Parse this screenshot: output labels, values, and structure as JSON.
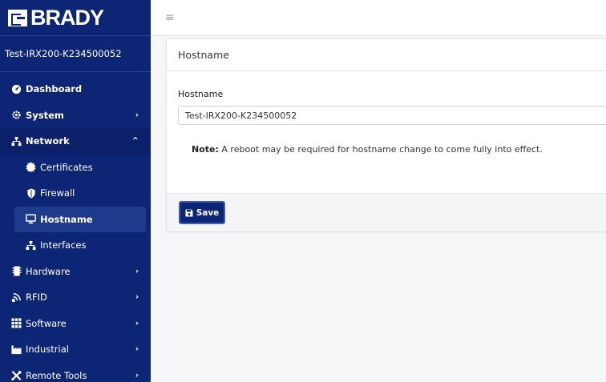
{
  "brand": {
    "name": "BRADY"
  },
  "sidebar": {
    "device_name": "Test-IRX200-K234500052",
    "items": [
      {
        "label": "Dashboard",
        "icon": "dashboard-icon"
      },
      {
        "label": "System",
        "icon": "gears-icon",
        "chevron": "›"
      },
      {
        "label": "Network",
        "icon": "network-icon",
        "chevron": "^"
      },
      {
        "label": "Certificates",
        "icon": "certificate-icon"
      },
      {
        "label": "Firewall",
        "icon": "shield-icon"
      },
      {
        "label": "Hostname",
        "icon": "monitor-icon"
      },
      {
        "label": "Interfaces",
        "icon": "network-icon"
      },
      {
        "label": "Hardware",
        "icon": "hardware-icon",
        "chevron": "›"
      },
      {
        "label": "RFID",
        "icon": "rfid-icon",
        "chevron": "›"
      },
      {
        "label": "Software",
        "icon": "grid-icon",
        "chevron": "›"
      },
      {
        "label": "Industrial",
        "icon": "industry-icon",
        "chevron": "›"
      },
      {
        "label": "Remote Tools",
        "icon": "tools-icon",
        "chevron": "›"
      }
    ]
  },
  "topbar": {
    "menu_icon": "≡"
  },
  "card": {
    "title": "Hostname",
    "field_label": "Hostname",
    "field_value": "Test-IRX200-K234500052",
    "note_label": "Note:",
    "note_text": " A reboot may be required for hostname change to come fully into effect.",
    "save_label": "Save"
  },
  "colors": {
    "sidebar_bg": "#0d2575",
    "accent": "#0d2575",
    "button_border": "#3f5db7"
  }
}
